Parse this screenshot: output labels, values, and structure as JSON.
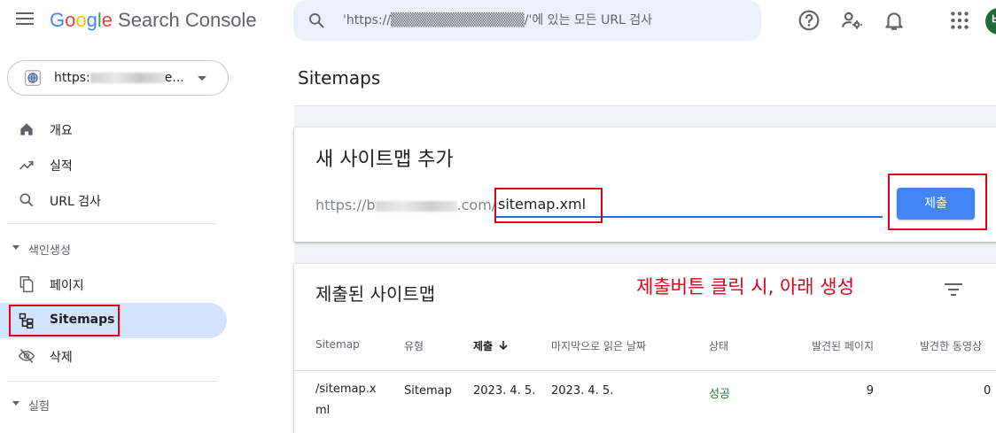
{
  "header": {
    "brand_g": [
      "G",
      "o",
      "o",
      "g",
      "l",
      "e"
    ],
    "brand_product": "Search Console",
    "search_placeholder": "'https://▒▒▒▒▒▒▒▒▒▒▒▒▒▒/'에 있는 모든 URL 검사",
    "avatar_letter": "버",
    "icons": [
      "menu-icon",
      "search-icon",
      "help-icon",
      "manage-users-icon",
      "notifications-icon",
      "apps-icon"
    ]
  },
  "sidebar": {
    "property_prefix": "https:",
    "property_suffix": "e...",
    "items": [
      {
        "label": "개요",
        "icon": "home-icon"
      },
      {
        "label": "실적",
        "icon": "trending-up-icon"
      },
      {
        "label": "URL 검사",
        "icon": "search-icon"
      }
    ],
    "section_index": "색인생성",
    "index_items": [
      {
        "label": "페이지",
        "icon": "pages-icon"
      },
      {
        "label": "Sitemaps",
        "icon": "sitemap-icon",
        "active": true
      },
      {
        "label": "삭제",
        "icon": "visibility-off-icon"
      }
    ],
    "section_experiment": "실험"
  },
  "main": {
    "page_title": "Sitemaps",
    "add_card": {
      "title": "새 사이트맵 추가",
      "url_prefix_start": "https://b",
      "url_prefix_end": ".com/",
      "input_value": "sitemap.xml",
      "submit_label": "제출"
    },
    "list_card": {
      "title": "제출된 사이트맵",
      "annotation": "제출버튼 클릭 시, 아래 생성",
      "columns": [
        "Sitemap",
        "유형",
        "제출",
        "마지막으로 읽은 날짜",
        "상태",
        "발견된 페이지",
        "발견한 동영상"
      ],
      "sort_icon": "arrow-down-icon",
      "rows": [
        {
          "sitemap": "/sitemap.xml",
          "sitemap_line1": "/sitemap.x",
          "sitemap_line2": "ml",
          "type": "Sitemap",
          "submitted": "2023. 4. 5.",
          "last_read": "2023. 4. 5.",
          "status": "성공",
          "pages": "9",
          "videos": "0"
        }
      ]
    }
  },
  "colors": {
    "accent": "#1a73e8",
    "button": "#4285f4",
    "active_nav": "#d3e3fd",
    "success": "#188038",
    "annotation_red": "#e2001a"
  }
}
